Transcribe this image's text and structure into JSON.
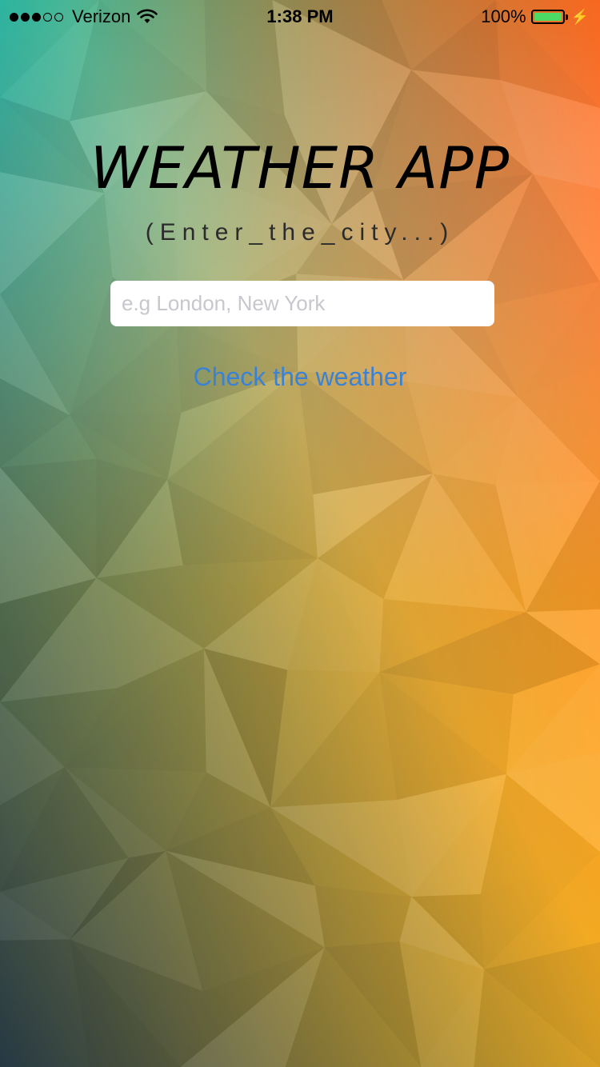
{
  "status_bar": {
    "carrier": "Verizon",
    "time": "1:38 PM",
    "battery_percent": "100%",
    "signal_bars_filled": 3,
    "signal_bars_total": 5,
    "battery_level": 1.0,
    "battery_color": "#4cd964",
    "icons": [
      "wifi-icon",
      "battery-icon",
      "charging-bolt-icon"
    ]
  },
  "main": {
    "title": "WEATHER APP",
    "subtitle": "(Enter_the_city...)",
    "city_input": {
      "value": "",
      "placeholder": "e.g London, New York"
    },
    "check_button_label": "Check the weather"
  },
  "colors": {
    "accent": "#3b82d4",
    "bg_teal": "#2fc4ab",
    "bg_orange": "#ff6a1f",
    "bg_yellow": "#fdc52c",
    "bg_navy": "#22384c"
  }
}
